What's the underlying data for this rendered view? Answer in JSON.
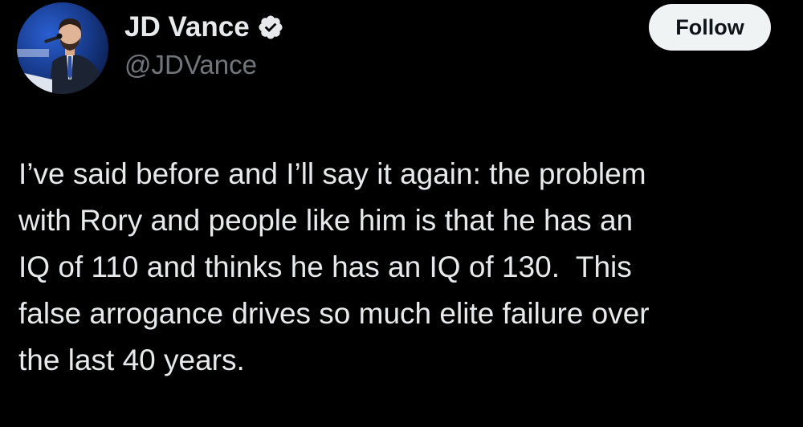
{
  "author": {
    "display_name": "JD Vance",
    "handle": "@JDVance",
    "verified": true,
    "verified_color": "#1d9bf0",
    "avatar_icon": "profile-photo"
  },
  "actions": {
    "follow_label": "Follow"
  },
  "tweet": {
    "lines": [
      "I’ve said before and I’ll say it again: the problem",
      "with Rory and people like him is that he has an",
      "IQ of 110 and thinks he has an IQ of 130.  This",
      "false arrogance drives so much elite failure over",
      "the last 40 years."
    ]
  },
  "colors": {
    "background": "#000000",
    "text_primary": "#e7e9ea",
    "text_secondary": "#71767b",
    "follow_bg": "#eff3f4",
    "follow_text": "#0f1419"
  }
}
